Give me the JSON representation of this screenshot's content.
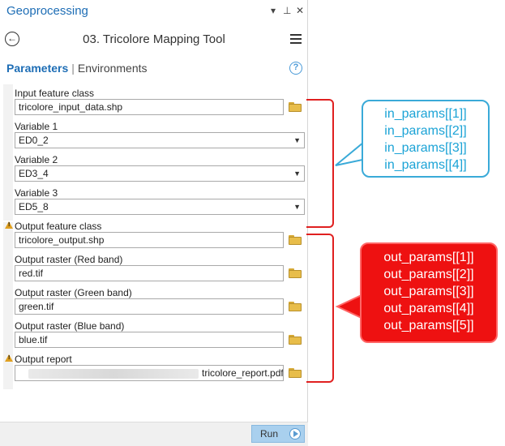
{
  "window": {
    "title": "Geoprocessing",
    "controls": {
      "menu": "▾",
      "pin": "⊥",
      "close": "✕"
    }
  },
  "tool": {
    "title": "03. Tricolore Mapping Tool"
  },
  "tabs": {
    "active": "Parameters",
    "separator": "|",
    "inactive": "Environments",
    "help": "?"
  },
  "params": {
    "input_feature_class": {
      "label": "Input feature class",
      "value": "tricolore_input_data.shp"
    },
    "variable1": {
      "label": "Variable 1",
      "value": "ED0_2"
    },
    "variable2": {
      "label": "Variable 2",
      "value": "ED3_4"
    },
    "variable3": {
      "label": "Variable 3",
      "value": "ED5_8"
    },
    "output_feature_class": {
      "label": "Output feature class",
      "value": "tricolore_output.shp"
    },
    "output_red": {
      "label": "Output raster (Red band)",
      "value": "red.tif"
    },
    "output_green": {
      "label": "Output raster (Green band)",
      "value": "green.tif"
    },
    "output_blue": {
      "label": "Output raster (Blue band)",
      "value": "blue.tif"
    },
    "output_report": {
      "label": "Output report",
      "value": "tricolore_report.pdf"
    }
  },
  "footer": {
    "run_label": "Run"
  },
  "annotations": {
    "in_params": [
      "in_params[[1]]",
      "in_params[[2]]",
      "in_params[[3]]",
      "in_params[[4]]"
    ],
    "out_params": [
      "out_params[[1]]",
      "out_params[[2]]",
      "out_params[[3]]",
      "out_params[[4]]",
      "out_params[[5]]"
    ],
    "in_color": "#1ba3d6",
    "out_color": "#ee1111",
    "bracket_color": "#e02020"
  },
  "icons": {
    "back": "back-arrow-icon",
    "menu": "hamburger-menu-icon",
    "help": "help-icon",
    "folder": "folder-browse-icon",
    "warning": "warning-icon",
    "run": "play-icon"
  }
}
